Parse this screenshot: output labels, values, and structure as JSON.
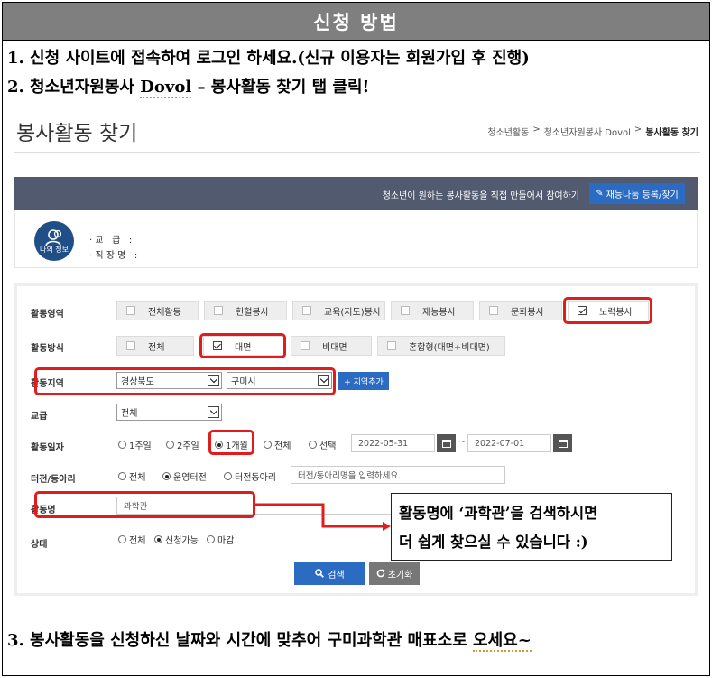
{
  "header": {
    "title": "신청 방법"
  },
  "steps": {
    "step1": "1. 신청 사이트에 접속하여 로그인 하세요.(신규 이용자는 회원가입 후 진행)",
    "step2_prefix": "2. 청소년자원봉사 ",
    "step2_dovol": "Dovol",
    "step2_suffix": " – 봉사활동 찾기 탭 클릭!",
    "step3_prefix": "3. 봉사활동을 신청하신 날짜와 시간에 맞추어 구미과학관 매표소로 ",
    "step3_suffix": "오세요~"
  },
  "page": {
    "title": "봉사활동 찾기",
    "breadcrumb": [
      "청소년활동",
      ">",
      "청소년자원봉사 Dovol",
      ">",
      "봉사활동 찾기"
    ]
  },
  "banner": {
    "text": "청소년이 원하는 봉사활동을 직접 만들어서 참여하기",
    "button_label": "재능나눔 등록/찾기"
  },
  "my_info": {
    "avatar_label": "나의 정보",
    "grade": "· 교   급   :",
    "school": "· 직 장 명   :"
  },
  "form": {
    "area": {
      "label": "활동영역",
      "options": [
        {
          "label": "전체활동",
          "checked": false
        },
        {
          "label": "헌혈봉사",
          "checked": false
        },
        {
          "label": "교육(지도)봉사",
          "checked": false
        },
        {
          "label": "재능봉사",
          "checked": false
        },
        {
          "label": "문화봉사",
          "checked": false
        },
        {
          "label": "노력봉사",
          "checked": true
        }
      ]
    },
    "method": {
      "label": "활동방식",
      "options": [
        {
          "label": "전체",
          "checked": false
        },
        {
          "label": "대면",
          "checked": true
        },
        {
          "label": "비대면",
          "checked": false
        },
        {
          "label": "혼합형(대면+비대면)",
          "checked": false
        }
      ]
    },
    "region": {
      "label": "활동지역",
      "province": "경상북도",
      "city": "구미시",
      "add_button": "+ 지역추가"
    },
    "grade": {
      "label": "교급",
      "value": "전체"
    },
    "date": {
      "label": "활동일자",
      "options": [
        {
          "label": "1주일",
          "on": false
        },
        {
          "label": "2주일",
          "on": false
        },
        {
          "label": "1개월",
          "on": true
        },
        {
          "label": "전체",
          "on": false
        },
        {
          "label": "선택",
          "on": false
        }
      ],
      "start": "2022-05-31",
      "tilde": "~",
      "end": "2022-07-01"
    },
    "club": {
      "label": "터전/동아리",
      "options": [
        {
          "label": "전체",
          "on": false
        },
        {
          "label": "운영터전",
          "on": true
        },
        {
          "label": "터전동아리",
          "on": false
        }
      ],
      "placeholder": "터전/동아리명을 입력하세요."
    },
    "activity_name": {
      "label": "활동명",
      "value": "과학관"
    },
    "status": {
      "label": "상태",
      "options": [
        {
          "label": "전체",
          "on": false
        },
        {
          "label": "신청가능",
          "on": true
        },
        {
          "label": "마감",
          "on": false
        }
      ]
    },
    "search_button": "검색",
    "reset_button": "초기화"
  },
  "callout": {
    "line1": "활동명에 ‘과학관’을  검색하시면",
    "line2": "더 쉽게 찾으실 수 있습니다 :)"
  },
  "colors": {
    "accent_blue": "#2b6bc2",
    "highlight_red": "#e01c1c",
    "banner": "#515a6e",
    "header": "#7f7f7f"
  }
}
